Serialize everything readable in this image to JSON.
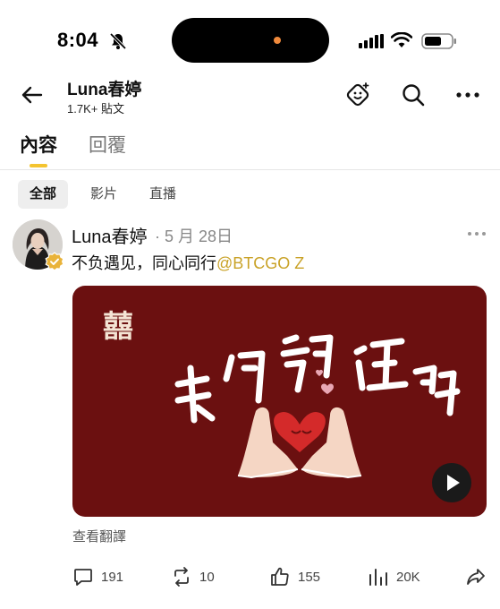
{
  "status_bar": {
    "time": "8:04"
  },
  "header": {
    "name": "Luna春婷",
    "post_count": "1.7K+ 貼文"
  },
  "tabs": [
    {
      "label": "內容",
      "active": true
    },
    {
      "label": "回覆",
      "active": false
    }
  ],
  "filters": [
    {
      "label": "全部",
      "active": true
    },
    {
      "label": "影片",
      "active": false
    },
    {
      "label": "直播",
      "active": false
    }
  ],
  "post": {
    "author": "Luna春婷",
    "date": "· 5 月 28日",
    "text": "不负遇见，同心同行",
    "mention": "@BTCGO Z",
    "media_character": "囍",
    "media_caption": "我们领证啦",
    "translate_label": "查看翻譯",
    "stats": {
      "replies": "191",
      "reposts": "10",
      "likes": "155",
      "views": "20K"
    }
  },
  "colors": {
    "accent": "#f4c430",
    "media_background": "#6b1010",
    "mention": "#c9a227"
  }
}
